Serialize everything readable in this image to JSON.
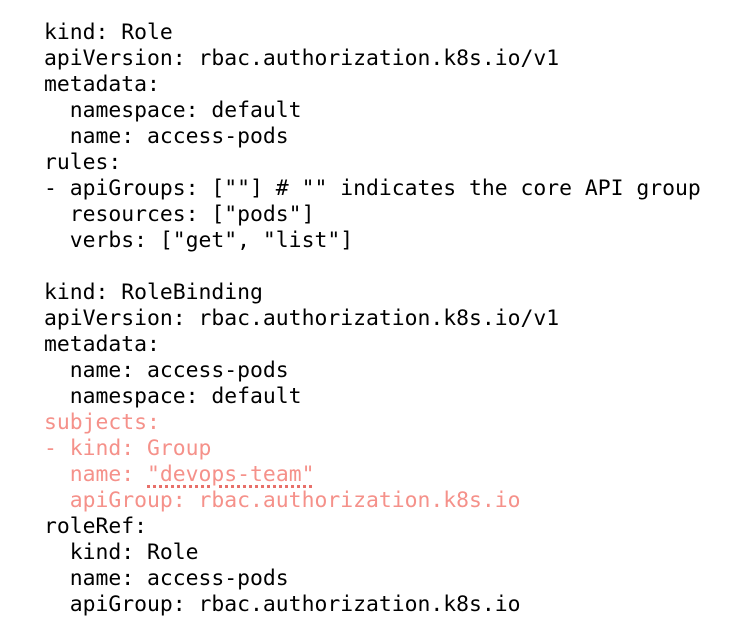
{
  "colors": {
    "text": "#000000",
    "highlight": "#f5918a",
    "squiggle": "#e8706a",
    "background": "#ffffff"
  },
  "lines": [
    "kind: Role",
    "apiVersion: rbac.authorization.k8s.io/v1",
    "metadata:",
    "  namespace: default",
    "  name: access-pods",
    "rules:",
    "- apiGroups: [\"\"] # \"\" indicates the core API group",
    "  resources: [\"pods\"]",
    "  verbs: [\"get\", \"list\"]",
    "",
    "kind: RoleBinding",
    "apiVersion: rbac.authorization.k8s.io/v1",
    "metadata:",
    "  name: access-pods",
    "  namespace: default",
    "subjects:",
    "- kind: Group",
    "  name: ",
    "  apiGroup: rbac.authorization.k8s.io",
    "roleRef:",
    "  kind: Role",
    "  name: access-pods",
    "  apiGroup: rbac.authorization.k8s.io"
  ],
  "squiggle_text": "\"devops-team\""
}
